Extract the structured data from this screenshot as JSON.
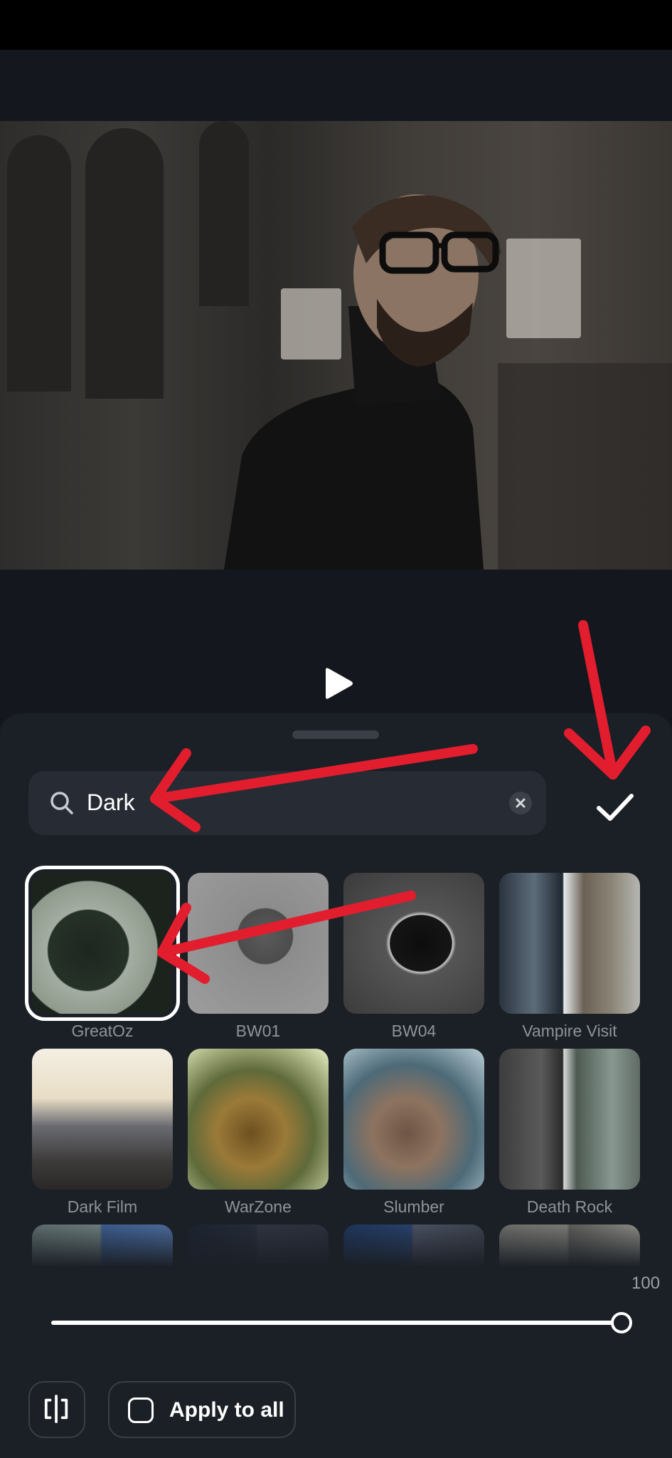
{
  "search": {
    "value": "Dark"
  },
  "filters": [
    {
      "label": "GreatOz",
      "selected": true
    },
    {
      "label": "BW01"
    },
    {
      "label": "BW04"
    },
    {
      "label": "Vampire Visit"
    },
    {
      "label": "Dark Film"
    },
    {
      "label": "WarZone"
    },
    {
      "label": "Slumber"
    },
    {
      "label": "Death Rock"
    }
  ],
  "intensity": {
    "value": "100",
    "level_fraction": 1.0
  },
  "apply_all": {
    "label": "Apply to all",
    "checked": false
  },
  "colors": {
    "sheet": "#1b1f26",
    "search_bg": "#272c34",
    "annotation_red": "#e21d2e"
  }
}
